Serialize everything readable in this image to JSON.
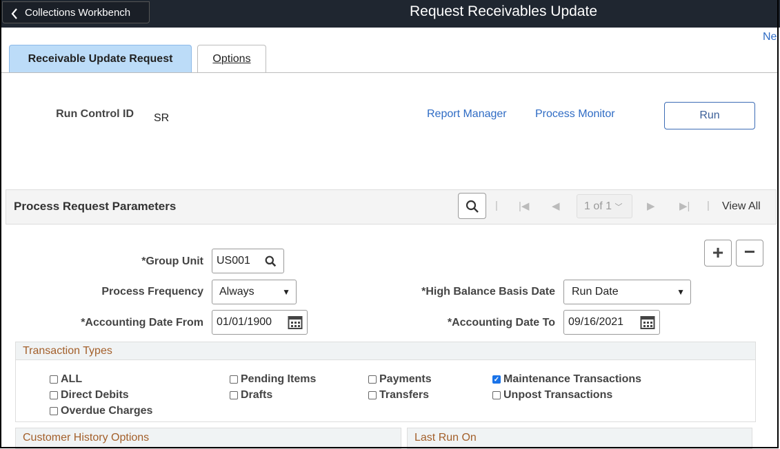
{
  "header": {
    "back_label": "Collections Workbench",
    "title": "Request Receivables Update",
    "new_window_link": "Ne"
  },
  "tabs": [
    {
      "label": "Receivable Update Request"
    },
    {
      "label": "Options"
    }
  ],
  "run_control": {
    "label": "Run Control ID",
    "value": "SR",
    "report_manager": "Report Manager",
    "process_monitor": "Process Monitor",
    "run_label": "Run"
  },
  "section": {
    "title": "Process Request Parameters",
    "pager": "1 of 1",
    "view_all": "View All"
  },
  "fields": {
    "group_unit": {
      "label": "*Group Unit",
      "value": "US001"
    },
    "process_frequency": {
      "label": "Process Frequency",
      "value": "Always"
    },
    "acct_from": {
      "label": "*Accounting Date From",
      "value": "01/01/1900"
    },
    "high_balance": {
      "label": "*High Balance Basis Date",
      "value": "Run Date"
    },
    "acct_to": {
      "label": "*Accounting Date To",
      "value": "09/16/2021"
    }
  },
  "transaction_types": {
    "title": "Transaction Types",
    "items": [
      {
        "label": "ALL",
        "checked": false
      },
      {
        "label": "Direct Debits",
        "checked": false
      },
      {
        "label": "Overdue Charges",
        "checked": false
      },
      {
        "label": "Pending Items",
        "checked": false
      },
      {
        "label": "Drafts",
        "checked": false
      },
      {
        "label": "Payments",
        "checked": false
      },
      {
        "label": "Transfers",
        "checked": false
      },
      {
        "label": "Maintenance Transactions",
        "checked": true
      },
      {
        "label": "Unpost Transactions",
        "checked": false
      }
    ]
  },
  "customer_history": {
    "title": "Customer History Options"
  },
  "last_run": {
    "title": "Last Run On"
  }
}
